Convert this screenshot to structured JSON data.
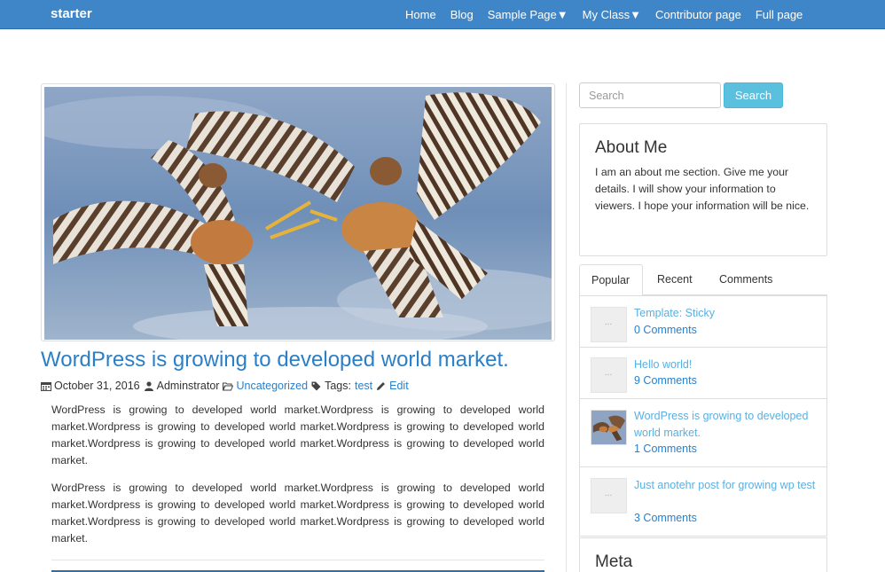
{
  "navbar": {
    "brand": "starter",
    "items": [
      "Home",
      "Blog",
      "Sample Page▼",
      "My Class▼",
      "Contributor page",
      "Full page"
    ]
  },
  "post": {
    "title": "WordPress is growing to developed world market.",
    "date": "October 31, 2016",
    "author": "Adminstrator",
    "category": "Uncategorized",
    "tags_label": "Tags:",
    "tag": "test",
    "edit": "Edit",
    "paragraphs": [
      "WordPress is growing to developed world market.Wordpress is growing to developed world market.Wordpress is growing to developed world market.Wordpress is growing to developed world market.Wordpress is growing to developed world market.Wordpress is growing to developed world market.",
      "WordPress is growing to developed world market.Wordpress is growing to developed world market.Wordpress is growing to developed world market.Wordpress is growing to developed world market.Wordpress is growing to developed world market.Wordpress is growing to developed world market."
    ]
  },
  "sidebar": {
    "search": {
      "placeholder": "Search",
      "button": "Search"
    },
    "about": {
      "title": "About Me",
      "text": "I am an about me section. Give me your details. I will show your information to viewers. I hope your information will be nice."
    },
    "tabs": [
      "Popular",
      "Recent",
      "Comments"
    ],
    "popular": [
      {
        "title": "Template: Sticky",
        "comments": "0 Comments"
      },
      {
        "title": "Hello world!",
        "comments": "9 Comments"
      },
      {
        "title": "WordPress is growing to developed world market.",
        "comments": "1 Comments"
      },
      {
        "title": "Just anotehr post for growing wp test",
        "comments": "3 Comments"
      }
    ],
    "meta_title": "Meta"
  },
  "colors": {
    "navbar": "#3e86c8",
    "link": "#2a7fc9",
    "search_button": "#5bc0de"
  }
}
